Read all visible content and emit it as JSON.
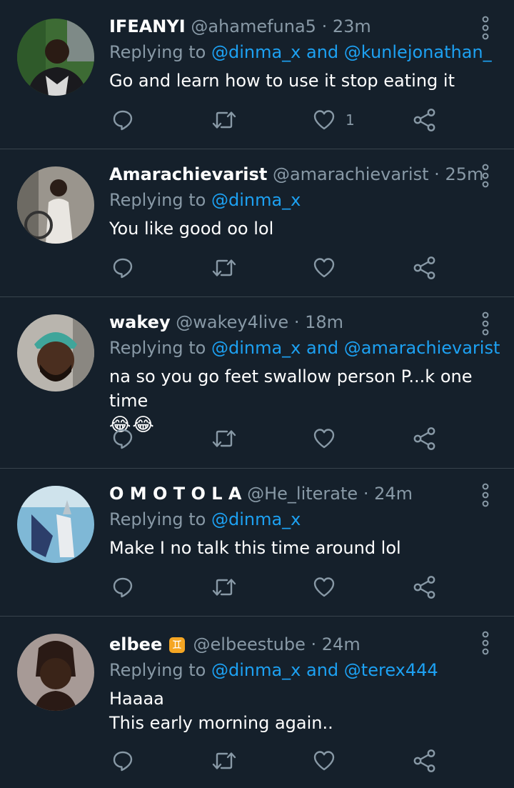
{
  "tweets": [
    {
      "name": "IFEANYI",
      "handle": "@ahamefuna5",
      "dot": "·",
      "time": "23m",
      "reply_prefix": "Replying to",
      "reply_to": "@dinma_x",
      "reply_and": "and",
      "reply_to_2": "@kunlejonathan_",
      "text": "Go and learn how to use it stop eating it",
      "like_count": "1"
    },
    {
      "name": "Amarachievarist",
      "handle": "@amarachievarist",
      "dot": "·",
      "time": "25m",
      "reply_prefix": "Replying to",
      "reply_to": "@dinma_x",
      "text": "You like good oo lol"
    },
    {
      "name": "wakey",
      "handle": "@wakey4live",
      "dot": "·",
      "time": "18m",
      "reply_prefix": "Replying to",
      "reply_to": "@dinma_x",
      "reply_and": "and",
      "reply_to_2": "@amarachievarist",
      "text": "na so you go feet swallow person P...k one time",
      "emoji": [
        "😂",
        "😂"
      ]
    },
    {
      "name": "O M O T O L A",
      "handle": "@He_literate",
      "dot": "·",
      "time": "24m",
      "reply_prefix": "Replying to",
      "reply_to": "@dinma_x",
      "text": "Make I no talk this time around lol"
    },
    {
      "name": "elbee",
      "badge": "♊",
      "handle": "@elbeestube",
      "dot": "·",
      "time": "24m",
      "reply_prefix": "Replying to",
      "reply_to": "@dinma_x",
      "reply_and": "and",
      "reply_to_2": "@terex444",
      "text_line1": "Haaaa",
      "text_line2": "This early morning again.."
    }
  ],
  "icons": {
    "reply": "reply-icon",
    "retweet": "retweet-icon",
    "like": "heart-icon",
    "share": "share-icon",
    "more": "more-vertical-icon"
  },
  "colors": {
    "background": "#15202b",
    "divider": "#38444d",
    "secondary_text": "#8899a6",
    "link": "#1da1f2",
    "primary_text": "#ffffff"
  }
}
